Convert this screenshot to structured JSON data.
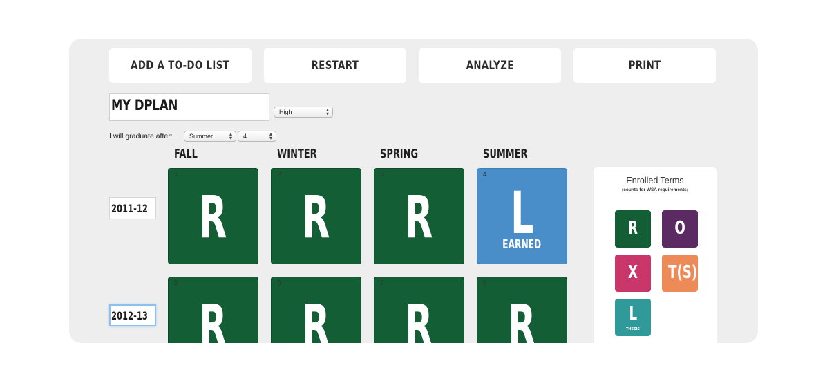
{
  "toolbar": {
    "buttons": [
      {
        "label": "ADD A TO-DO LIST"
      },
      {
        "label": "RESTART"
      },
      {
        "label": "ANALYZE"
      },
      {
        "label": "PRINT"
      }
    ]
  },
  "plan": {
    "name": "MY DPLAN",
    "level_select": "High"
  },
  "graduation": {
    "label": "I will graduate after:",
    "term_select": "Summer",
    "number_select": "4"
  },
  "seasons": [
    "FALL",
    "WINTER",
    "SPRING",
    "SUMMER"
  ],
  "years": [
    {
      "label": "2011-12",
      "terms": [
        {
          "num": "1",
          "letter": "R",
          "sub": "",
          "color": "#135e34"
        },
        {
          "num": "2",
          "letter": "R",
          "sub": "",
          "color": "#135e34"
        },
        {
          "num": "3",
          "letter": "R",
          "sub": "",
          "color": "#135e34"
        },
        {
          "num": "4",
          "letter": "L",
          "sub": "EARNED",
          "color": "#4a8ec9"
        }
      ]
    },
    {
      "label": "2012-13",
      "terms": [
        {
          "num": "5",
          "letter": "R",
          "sub": "",
          "color": "#135e34"
        },
        {
          "num": "6",
          "letter": "R",
          "sub": "",
          "color": "#135e34"
        },
        {
          "num": "7",
          "letter": "R",
          "sub": "",
          "color": "#135e34"
        },
        {
          "num": "8",
          "letter": "R",
          "sub": "",
          "color": "#135e34"
        }
      ]
    }
  ],
  "legend": {
    "title": "Enrolled Terms",
    "subtitle": "(counts for WSA requirements)",
    "chips": [
      {
        "letter": "R",
        "sub": "",
        "color": "#135e34"
      },
      {
        "letter": "O",
        "sub": "",
        "color": "#5b2a62"
      },
      {
        "letter": "X",
        "sub": "",
        "color": "#c8366a"
      },
      {
        "letter": "T(S)",
        "sub": "",
        "color": "#ee8a57"
      },
      {
        "letter": "L",
        "sub": "THESIS",
        "color": "#2f9a99"
      }
    ]
  }
}
